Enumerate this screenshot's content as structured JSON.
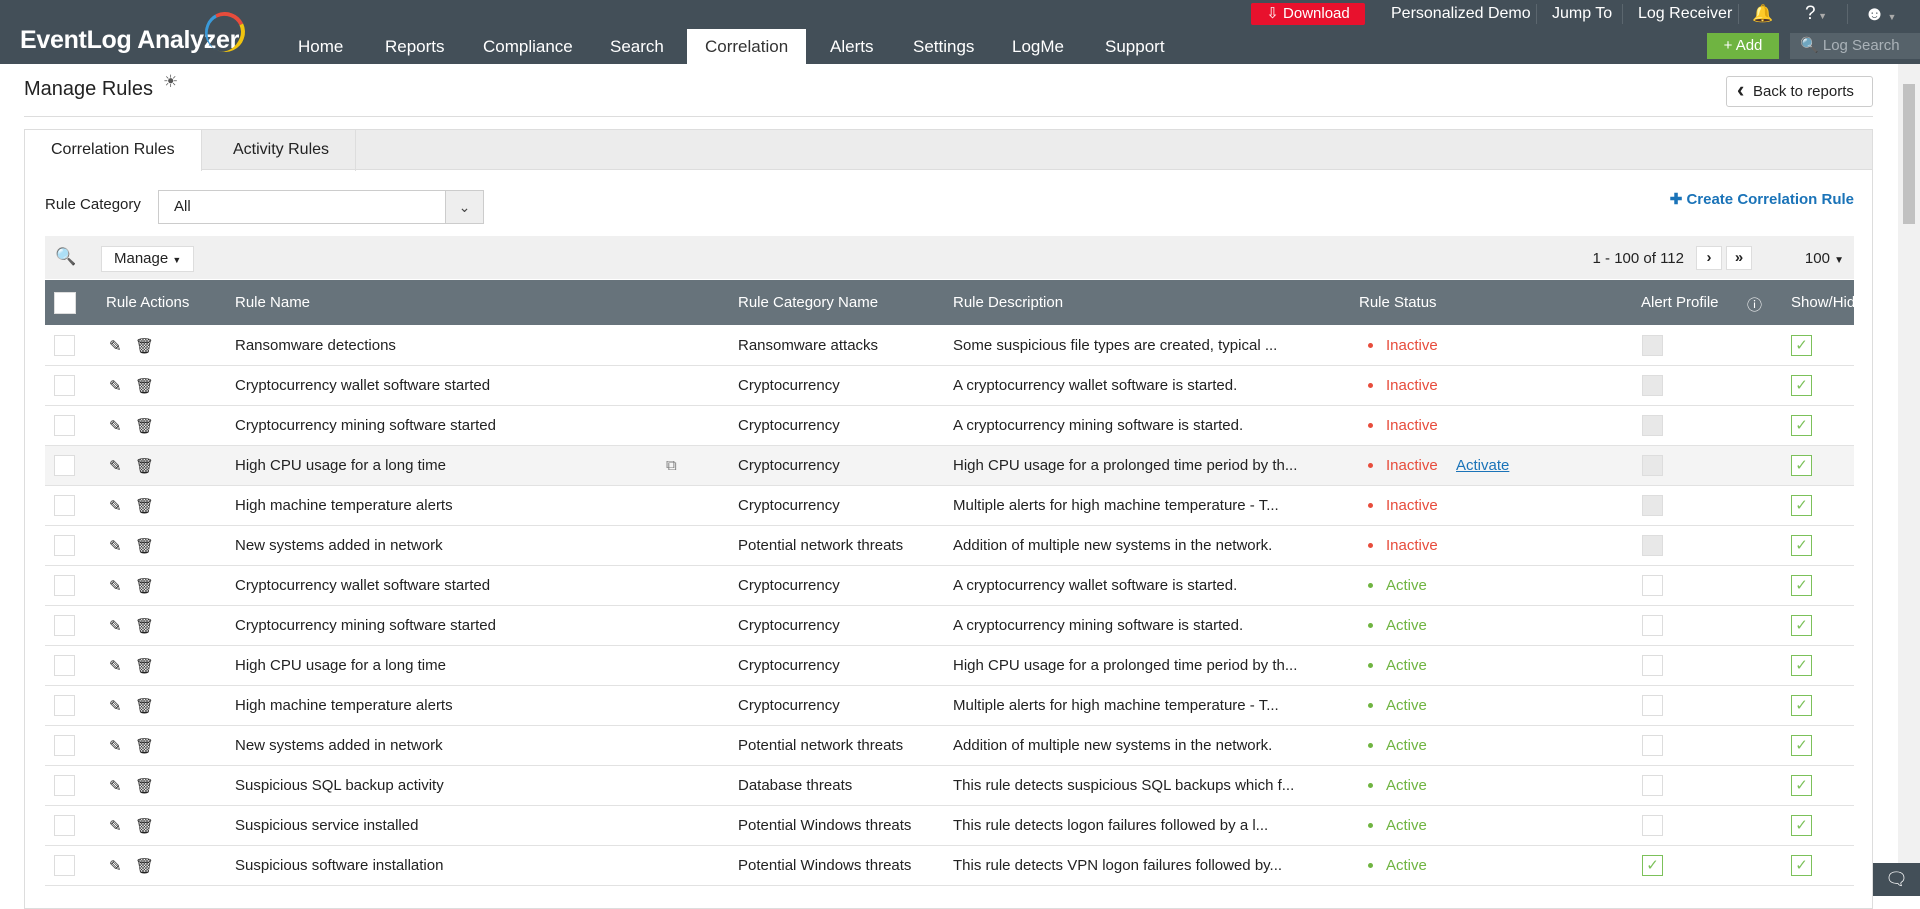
{
  "app": {
    "logo": "EventLog Analyzer"
  },
  "nav": [
    "Home",
    "Reports",
    "Compliance",
    "Search",
    "Correlation",
    "Alerts",
    "Settings",
    "LogMe",
    "Support"
  ],
  "nav_active": "Correlation",
  "topbar": {
    "download": "Download",
    "demo": "Personalized Demo",
    "jump": "Jump To",
    "receiver": "Log Receiver",
    "help": "?",
    "add": "Add",
    "search_placeholder": "Log Search"
  },
  "page": {
    "title": "Manage Rules",
    "back": "Back to reports"
  },
  "tabs": [
    "Correlation Rules",
    "Activity Rules"
  ],
  "filter": {
    "label": "Rule Category",
    "value": "All",
    "create": "Create Correlation Rule"
  },
  "toolbar": {
    "manage": "Manage",
    "pagination": "1 - 100 of 112",
    "per_page": "100"
  },
  "columns": [
    "Rule Actions",
    "Rule Name",
    "Rule Category Name",
    "Rule Description",
    "Rule Status",
    "Alert Profile",
    "Show/Hide"
  ],
  "activate_label": "Activate",
  "colors": {
    "header": "#434f58",
    "active": "#6fb441",
    "inactive": "#e74c3c",
    "link": "#1a73b8",
    "download": "#e8112d"
  },
  "rows": [
    {
      "name": "Ransomware detections",
      "category": "Ransomware attacks",
      "description": "Some suspicious file types are created, typical ...",
      "status": "Inactive",
      "alert": "disabled",
      "show": true
    },
    {
      "name": "Cryptocurrency wallet software started",
      "category": "Cryptocurrency",
      "description": "A cryptocurrency wallet software is started.",
      "status": "Inactive",
      "alert": "disabled",
      "show": true
    },
    {
      "name": "Cryptocurrency mining software started",
      "category": "Cryptocurrency",
      "description": "A cryptocurrency mining software is started.",
      "status": "Inactive",
      "alert": "disabled",
      "show": true
    },
    {
      "name": "High CPU usage for a long time",
      "category": "Cryptocurrency",
      "description": "High CPU usage for a prolonged time period by th...",
      "status": "Inactive",
      "alert": "disabled",
      "show": true,
      "hover": true
    },
    {
      "name": "High machine temperature alerts",
      "category": "Cryptocurrency",
      "description": "Multiple alerts for high machine temperature - T...",
      "status": "Inactive",
      "alert": "disabled",
      "show": true
    },
    {
      "name": "New systems added in network",
      "category": "Potential network threats",
      "description": "Addition of multiple new systems in the network.",
      "status": "Inactive",
      "alert": "disabled",
      "show": true
    },
    {
      "name": "Cryptocurrency wallet software started",
      "category": "Cryptocurrency",
      "description": "A cryptocurrency wallet software is started.",
      "status": "Active",
      "alert": "off",
      "show": true
    },
    {
      "name": "Cryptocurrency mining software started",
      "category": "Cryptocurrency",
      "description": "A cryptocurrency mining software is started.",
      "status": "Active",
      "alert": "off",
      "show": true
    },
    {
      "name": "High CPU usage for a long time",
      "category": "Cryptocurrency",
      "description": "High CPU usage for a prolonged time period by th...",
      "status": "Active",
      "alert": "off",
      "show": true
    },
    {
      "name": "High machine temperature alerts",
      "category": "Cryptocurrency",
      "description": "Multiple alerts for high machine temperature - T...",
      "status": "Active",
      "alert": "off",
      "show": true
    },
    {
      "name": "New systems added in network",
      "category": "Potential network threats",
      "description": "Addition of multiple new systems in the network.",
      "status": "Active",
      "alert": "off",
      "show": true
    },
    {
      "name": "Suspicious SQL backup activity",
      "category": "Database threats",
      "description": "This rule detects suspicious SQL backups which f...",
      "status": "Active",
      "alert": "off",
      "show": true
    },
    {
      "name": "Suspicious service installed",
      "category": "Potential Windows threats",
      "description": "This rule detects logon failures followed by a l...",
      "status": "Active",
      "alert": "off",
      "show": true
    },
    {
      "name": "Suspicious software installation",
      "category": "Potential Windows threats",
      "description": "This rule detects VPN logon failures followed by...",
      "status": "Active",
      "alert": "on",
      "show": true
    }
  ]
}
